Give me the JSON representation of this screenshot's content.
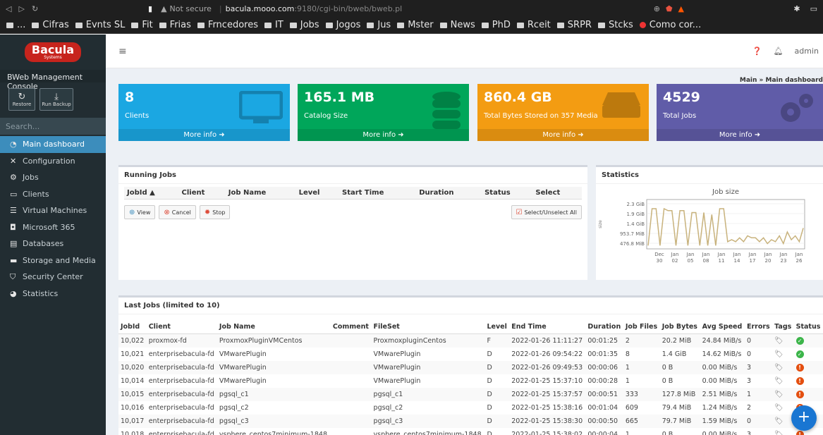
{
  "browser": {
    "not_secure": "Not secure",
    "host": "bacula.mooo.com",
    "path": ":9180/cgi-bin/bweb/bweb.pl",
    "bookmarks": [
      "...",
      "Cifras",
      "Evnts SL",
      "Fit",
      "Frias",
      "Frncedores",
      "IT",
      "Jobs",
      "Jogos",
      "Jus",
      "Mster",
      "News",
      "PhD",
      "Rceit",
      "SRPR",
      "Stcks",
      "Como cor..."
    ]
  },
  "sidebar": {
    "logo_text": "Bacula",
    "logo_sub": "Systems",
    "console_title": "BWeb Management Console",
    "restore_label": "Restore",
    "run_backup_label": "Run Backup",
    "search_placeholder": "Search...",
    "items": [
      {
        "label": "Main dashboard",
        "icon": "dashboard-icon"
      },
      {
        "label": "Configuration",
        "icon": "wrench-icon"
      },
      {
        "label": "Jobs",
        "icon": "cogs-icon"
      },
      {
        "label": "Clients",
        "icon": "monitor-icon"
      },
      {
        "label": "Virtual Machines",
        "icon": "server-icon"
      },
      {
        "label": "Microsoft 365",
        "icon": "office-icon"
      },
      {
        "label": "Databases",
        "icon": "database-icon"
      },
      {
        "label": "Storage and Media",
        "icon": "drive-icon"
      },
      {
        "label": "Security Center",
        "icon": "shield-icon"
      },
      {
        "label": "Statistics",
        "icon": "pie-chart-icon"
      }
    ]
  },
  "topnav": {
    "user": "admin"
  },
  "breadcrumb": {
    "root": "Main",
    "current": "Main dashboard"
  },
  "info_boxes": {
    "clients": {
      "value": "8",
      "label": "Clients",
      "more": "More info"
    },
    "catalog": {
      "value": "165.1 MB",
      "label": "Catalog Size",
      "more": "More info"
    },
    "bytes": {
      "value": "860.4 GB",
      "label": "Total Bytes Stored on 357 Media",
      "more": "More info"
    },
    "jobs": {
      "value": "4529",
      "label": "Total Jobs",
      "more": "More info"
    }
  },
  "running_jobs": {
    "title": "Running Jobs",
    "columns": [
      "JobId ▲",
      "Client",
      "Job Name",
      "Level",
      "Start Time",
      "Duration",
      "Status",
      "Select"
    ],
    "view": "View",
    "cancel": "Cancel",
    "stop": "Stop",
    "select_all": "Select/Unselect All"
  },
  "statistics": {
    "title": "Statistics"
  },
  "chart_data": {
    "type": "line",
    "title": "Job size",
    "ylabel": "size",
    "y_tick_labels": [
      "2.3 GiB",
      "1.9 GiB",
      "1.4 GiB",
      "953.7 MiB",
      "476.8 MiB"
    ],
    "x_tick_labels": [
      [
        "Dec",
        "30"
      ],
      [
        "Jan",
        "02"
      ],
      [
        "Jan",
        "05"
      ],
      [
        "Jan",
        "08"
      ],
      [
        "Jan",
        "11"
      ],
      [
        "Jan",
        "14"
      ],
      [
        "Jan",
        "17"
      ],
      [
        "Jan",
        "20"
      ],
      [
        "Jan",
        "23"
      ],
      [
        "Jan",
        "26"
      ]
    ],
    "series": [
      {
        "color": "#c8b27c",
        "values": [
          0.1,
          2.0,
          2.0,
          0.1,
          2.0,
          1.9,
          1.9,
          0.1,
          1.9,
          1.9,
          0.1,
          1.8,
          1.8,
          0.1,
          1.8,
          0.1,
          1.7,
          0.1,
          2.0,
          2.0,
          0.3,
          0.4,
          0.3,
          0.5,
          0.3,
          0.6,
          0.5,
          0.5,
          0.3,
          0.5,
          0.2,
          0.4,
          0.3,
          0.6,
          0.2,
          0.8,
          0.4,
          0.6,
          0.3,
          1.0
        ]
      }
    ],
    "ylim": [
      0,
      2.4
    ],
    "grid": true
  },
  "last_jobs": {
    "title": "Last Jobs (limited to 10)",
    "columns": [
      "JobId",
      "Client",
      "Job Name",
      "Comment",
      "FileSet",
      "Level",
      "End Time",
      "Duration",
      "Job Files",
      "Job Bytes",
      "Avg Speed",
      "Errors",
      "Tags",
      "Status"
    ],
    "rows": [
      {
        "jobid": "10,022",
        "client": "proxmox-fd",
        "jobname": "ProxmoxPluginVMCentos",
        "comment": "",
        "fileset": "ProxmoxpluginCentos",
        "level": "F",
        "endtime": "2022-01-26 11:11:27",
        "duration": "00:01:25",
        "files": "2",
        "bytes": "20.2 MiB",
        "speed": "24.84 MiB/s",
        "errors": "0",
        "status": "ok"
      },
      {
        "jobid": "10,021",
        "client": "enterprisebacula-fd",
        "jobname": "VMwarePlugin",
        "comment": "",
        "fileset": "VMwarePlugin",
        "level": "D",
        "endtime": "2022-01-26 09:54:22",
        "duration": "00:01:35",
        "files": "8",
        "bytes": "1.4 GiB",
        "speed": "14.62 MiB/s",
        "errors": "0",
        "status": "ok"
      },
      {
        "jobid": "10,020",
        "client": "enterprisebacula-fd",
        "jobname": "VMwarePlugin",
        "comment": "",
        "fileset": "VMwarePlugin",
        "level": "D",
        "endtime": "2022-01-26 09:49:53",
        "duration": "00:00:06",
        "files": "1",
        "bytes": "0 B",
        "speed": "0.00 MiB/s",
        "errors": "3",
        "status": "warn"
      },
      {
        "jobid": "10,014",
        "client": "enterprisebacula-fd",
        "jobname": "VMwarePlugin",
        "comment": "",
        "fileset": "VMwarePlugin",
        "level": "D",
        "endtime": "2022-01-25 15:37:10",
        "duration": "00:00:28",
        "files": "1",
        "bytes": "0 B",
        "speed": "0.00 MiB/s",
        "errors": "3",
        "status": "warn"
      },
      {
        "jobid": "10,015",
        "client": "enterprisebacula-fd",
        "jobname": "pgsql_c1",
        "comment": "",
        "fileset": "pgsql_c1",
        "level": "D",
        "endtime": "2022-01-25 15:37:57",
        "duration": "00:00:51",
        "files": "333",
        "bytes": "127.8 MiB",
        "speed": "2.51 MiB/s",
        "errors": "1",
        "status": "warn"
      },
      {
        "jobid": "10,016",
        "client": "enterprisebacula-fd",
        "jobname": "pgsql_c2",
        "comment": "",
        "fileset": "pgsql_c2",
        "level": "D",
        "endtime": "2022-01-25 15:38:16",
        "duration": "00:01:04",
        "files": "609",
        "bytes": "79.4 MiB",
        "speed": "1.24 MiB/s",
        "errors": "2",
        "status": "warn"
      },
      {
        "jobid": "10,017",
        "client": "enterprisebacula-fd",
        "jobname": "pgsql_c3",
        "comment": "",
        "fileset": "pgsql_c3",
        "level": "D",
        "endtime": "2022-01-25 15:38:30",
        "duration": "00:00:50",
        "files": "665",
        "bytes": "79.7 MiB",
        "speed": "1.59 MiB/s",
        "errors": "0",
        "status": "warn"
      },
      {
        "jobid": "10,018",
        "client": "enterprisebacula-fd",
        "jobname": "vsphere_centos7minimum-1848",
        "comment": "",
        "fileset": "vsphere_centos7minimum-1848",
        "level": "D",
        "endtime": "2022-01-25 15:38:02",
        "duration": "00:00:04",
        "files": "1",
        "bytes": "0 B",
        "speed": "0.00 MiB/s",
        "errors": "3",
        "status": "warn"
      }
    ]
  }
}
